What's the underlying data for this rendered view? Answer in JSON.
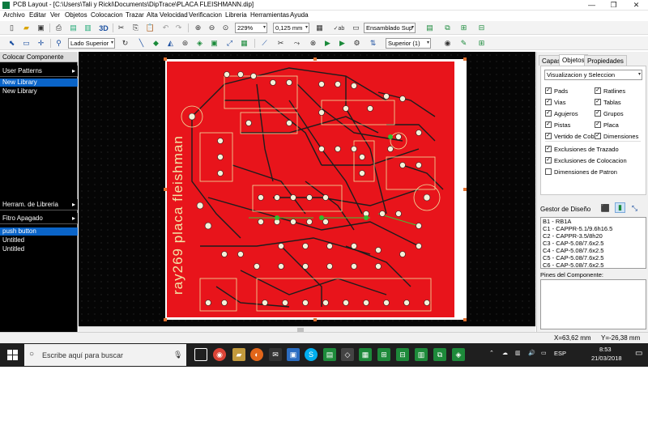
{
  "window": {
    "title": "PCB Layout - [C:\\Users\\Tali y Ricki\\Documents\\DipTrace\\PLACA FLEISHMANN.dip]",
    "minimize": "—",
    "maximize": "❐",
    "close": "✕"
  },
  "menu": [
    "Archivo",
    "Editar",
    "Ver",
    "Objetos",
    "Colocacion",
    "Trazar",
    "Alta Velocidad",
    "Verificacion",
    "Libreria",
    "Herramientas",
    "Ayuda"
  ],
  "toolbar1": {
    "zoom": "229%",
    "grid": "0,125 mm",
    "layer_mode": "Ensamblado Sup",
    "icon_3d": "3D"
  },
  "toolbar2": {
    "side": "Lado Superior",
    "layer": "Superior (1)"
  },
  "left_panel": {
    "header": "Colocar Componente",
    "patterns_dropdown": "User Patterns",
    "libraries": [
      "New Library",
      "New Library"
    ],
    "lib_tools": "Herram. de Libreria",
    "filter": "Fitro Apagado",
    "components": [
      "push button",
      "Untitled",
      "Untitled"
    ]
  },
  "right_panel": {
    "tabs": [
      "Capas",
      "Objetos",
      "Propiedades"
    ],
    "view_select": "Visualizacion y Seleccion",
    "checkboxes_left": [
      "Pads",
      "Vias",
      "Agujeros",
      "Pistas",
      "Vertido de Cobre"
    ],
    "checkboxes_right": [
      "Ratlines",
      "Tablas",
      "Grupos",
      "Placa",
      "Dimensiones"
    ],
    "exclusions": [
      "Exclusiones de Trazado",
      "Exclusiones de Colocacion",
      "Dimensiones de Patron"
    ],
    "exclusions_checked": [
      true,
      true,
      false
    ],
    "design_manager": "Gestor de Diseño",
    "components": [
      "B1 - RB1A",
      "C1 - CAPPR-5.1/9.6h16.5",
      "C2 - CAPPR-3.5/8h20",
      "C3 - CAP-5.08/7.6x2.5",
      "C4 - CAP-5.08/7.6x2.5",
      "C5 - CAP-5.08/7.6x2.5",
      "C6 - CAP-5.08/7.6x2.5"
    ],
    "pins_label": "Pines del Componente:"
  },
  "status": {
    "x": "X=63,62 mm",
    "y": "Y=-26,38 mm"
  },
  "board": {
    "silkscreen_text": "ray269  placa  fleishman",
    "copper_color": "#e8141b",
    "track_color": "#1d1d1d",
    "pad_color": "#f6f0d8"
  },
  "taskbar": {
    "search_placeholder": "Escribe aquí para buscar",
    "lang": "ESP",
    "time": "8:53",
    "date": "21/03/2018"
  }
}
